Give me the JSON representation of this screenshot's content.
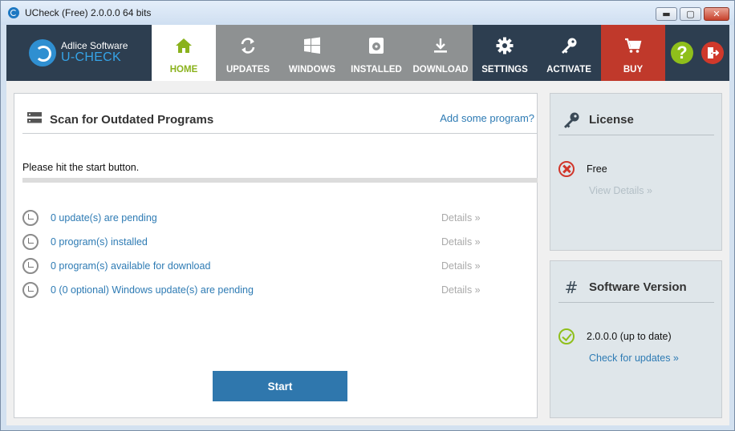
{
  "window": {
    "title": "UCheck (Free) 2.0.0.0 64 bits",
    "minimize_glyph": "▬",
    "maximize_glyph": "▢",
    "close_glyph": "✕"
  },
  "brand": {
    "company": "Adlice Software",
    "product": "U-CHECK"
  },
  "nav": {
    "home": "HOME",
    "updates": "UPDATES",
    "windows": "WINDOWS",
    "installed": "INSTALLED",
    "download": "DOWNLOAD",
    "settings": "SETTINGS",
    "activate": "ACTIVATE",
    "buy": "BUY",
    "help_glyph": "?"
  },
  "colors": {
    "nav_bg": "#2d3e50",
    "home_accent": "#8ab21c",
    "buy_red": "#c0392b",
    "link_blue": "#2e7bb4",
    "start_blue": "#2f77ad"
  },
  "scan": {
    "title": "Scan for Outdated Programs",
    "add_program_link": "Add some program?",
    "status": "Please hit the start button.",
    "progress_percent": 0,
    "rows": [
      {
        "label": "0 update(s) are pending",
        "details": "Details »"
      },
      {
        "label": "0 program(s) installed",
        "details": "Details »"
      },
      {
        "label": "0 program(s) available for download",
        "details": "Details »"
      },
      {
        "label": "0 (0 optional) Windows update(s) are pending",
        "details": "Details »"
      }
    ],
    "start_label": "Start"
  },
  "license": {
    "title": "License",
    "status": "Free",
    "view_details": "View Details »"
  },
  "version": {
    "title": "Software Version",
    "hash_glyph": "#",
    "status": "2.0.0.0 (up to date)",
    "check_link": "Check for updates »"
  }
}
